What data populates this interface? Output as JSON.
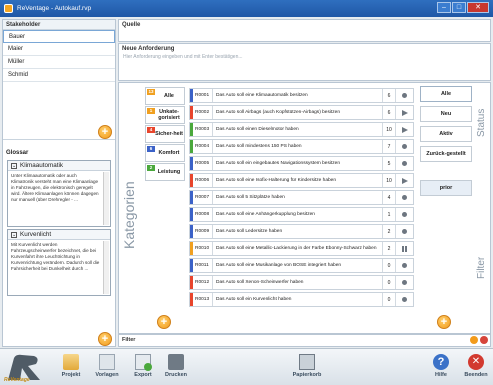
{
  "window": {
    "title": "ReVentage - Autokauf.rvp",
    "minimize": "–",
    "maximize": "□",
    "close": "✕"
  },
  "stakeholder": {
    "header": "Stakeholder",
    "items": [
      "Bauer",
      "Maier",
      "Müller",
      "Schmid"
    ],
    "selected_index": 0
  },
  "quelle": {
    "label": "Quelle"
  },
  "anforderung": {
    "label": "Neue Anforderung",
    "placeholder": "Hier Anforderung eingeben und mit Enter bestätigen..."
  },
  "glossar": {
    "header": "Glossar",
    "entries": [
      {
        "term": "Klimaautomatik",
        "text": "Unter Klimaautomatik oder auch Klimatronik versteht man eine Klimaanlage in Fahrzeugen, die elektronisch geregelt wird. Ältere Klimaanlagen können dagegen nur manuell (über Drehregler - ..."
      },
      {
        "term": "Kurvenlicht",
        "text": "Mit Kurvenlicht werden Fahrzeugscheinwerfer bezeichnet, die bei Kurvenfahrt ihre Leuchtrichtung in Kurvenrichtung verändern. Dadurch soll die Fahrsicherheit bei Dunkelheit durch ..."
      }
    ]
  },
  "kategorien": {
    "title": "Kategorien",
    "items": [
      {
        "label": "Alle",
        "tag": "13",
        "color": "#f0a020"
      },
      {
        "label": "Unkate-gorisiert",
        "tag": "1",
        "color": "#f0a020"
      },
      {
        "label": "Sicher-heit",
        "tag": "4",
        "color": "#e8452c"
      },
      {
        "label": "Komfort",
        "tag": "6",
        "color": "#3b62c8"
      },
      {
        "label": "Leistung",
        "tag": "2",
        "color": "#4aa83c"
      }
    ]
  },
  "requirements": [
    {
      "id": "R0001",
      "text": "Das Auto soll eine Klimaautomatik besitzen",
      "num": "6",
      "status": "dot",
      "color": "#3b62c8"
    },
    {
      "id": "R0002",
      "text": "Das Auto soll Airbags (auch Kopfstützen-Airbags) besitzen",
      "num": "6",
      "status": "play",
      "color": "#e8452c"
    },
    {
      "id": "R0003",
      "text": "Das Auto soll einen Dieselmotor haben",
      "num": "10",
      "status": "play",
      "color": "#4aa83c"
    },
    {
      "id": "R0004",
      "text": "Das Auto soll mindestens 150 PS haben",
      "num": "7",
      "status": "dot",
      "color": "#4aa83c"
    },
    {
      "id": "R0005",
      "text": "Das Auto soll ein eingebautes Navigationssystem besitzen",
      "num": "5",
      "status": "dot",
      "color": "#3b62c8"
    },
    {
      "id": "R0006",
      "text": "Das Auto soll eine Isofix-Halterung für Kindersitze haben",
      "num": "10",
      "status": "play",
      "color": "#e8452c"
    },
    {
      "id": "R0007",
      "text": "Das Auto soll 5 Sitzplätze haben",
      "num": "4",
      "status": "dot",
      "color": "#3b62c8"
    },
    {
      "id": "R0008",
      "text": "Das Auto soll eine Anhängerkupplung besitzen",
      "num": "1",
      "status": "dot",
      "color": "#3b62c8"
    },
    {
      "id": "R0009",
      "text": "Das Auto soll Ledersitze haben",
      "num": "2",
      "status": "dot",
      "color": "#3b62c8"
    },
    {
      "id": "R0010",
      "text": "Das Auto soll eine Metallic-Lackierung in der Farbe Ebonny-Schwarz haben",
      "num": "2",
      "status": "pause",
      "color": "#f0a020"
    },
    {
      "id": "R0011",
      "text": "Das Auto soll eine Musikanlage von BOSE integriert haben",
      "num": "0",
      "status": "dot",
      "color": "#3b62c8"
    },
    {
      "id": "R0012",
      "text": "Das Auto soll Xenon-Scheinwerfer haben",
      "num": "0",
      "status": "dot",
      "color": "#e8452c"
    },
    {
      "id": "R0013",
      "text": "Das Auto soll ein Kurvenlicht haben",
      "num": "0",
      "status": "dot",
      "color": "#e8452c"
    }
  ],
  "status": {
    "title": "Status",
    "buttons": [
      "Alle",
      "Neu",
      "Aktiv",
      "Zurück-gestellt"
    ],
    "selected_index": 0
  },
  "filter_panel": {
    "title": "Filter",
    "prior": "prior"
  },
  "filter": {
    "label": "Filter"
  },
  "toolbar": {
    "logo_text": "ReVentage",
    "projekt": "Projekt",
    "vorlagen": "Vorlagen",
    "export": "Export",
    "drucken": "Drucken",
    "papierkorb": "Papierkorb",
    "hilfe": "Hilfe",
    "beenden": "Beenden"
  },
  "icons": {
    "add": "plus-icon",
    "projekt": "folder-icon",
    "vorlagen": "template-icon",
    "export": "export-icon",
    "drucken": "printer-icon",
    "papierkorb": "trash-icon",
    "hilfe": "help-icon",
    "beenden": "exit-icon"
  }
}
